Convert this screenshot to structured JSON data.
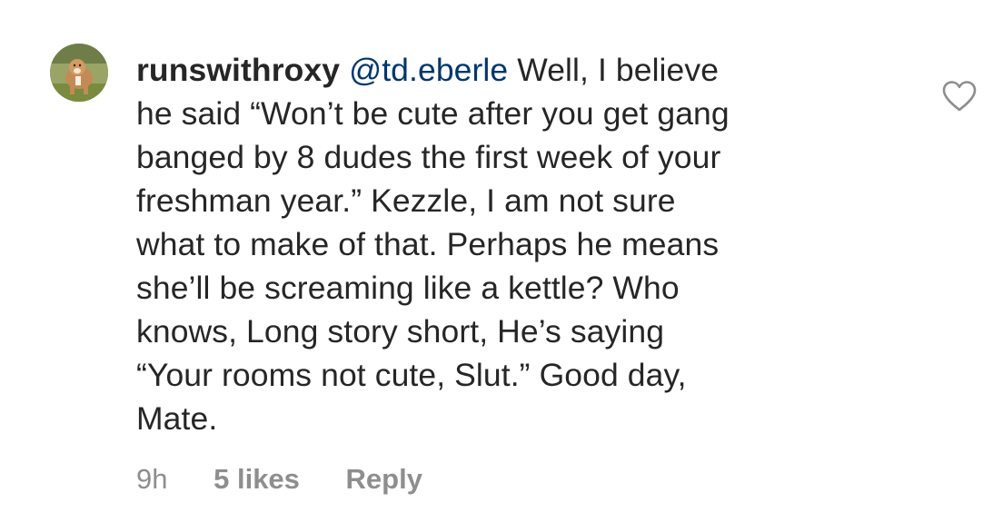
{
  "comment": {
    "avatar_icon": "user-avatar-dog-photo",
    "username": "runswithroxy",
    "mention": "@td.eberle",
    "first_line_rest": " Well, I believe",
    "lines": [
      "he said “Won’t be cute after you get gang",
      "banged by 8 dudes the first week of your",
      "freshman year.” Kezzle, I am not sure",
      "what to make of that. Perhaps he means",
      "she’ll be screaming like a kettle? Who",
      "knows, Long story short, He’s saying",
      "“Your rooms not cute, Slut.” Good day,",
      "Mate."
    ],
    "time": "9h",
    "likes": "5 likes",
    "reply_label": "Reply",
    "like_icon": "heart-outline-icon"
  },
  "colors": {
    "text": "#262626",
    "mention": "#00376b",
    "meta": "#8e8e8e"
  }
}
